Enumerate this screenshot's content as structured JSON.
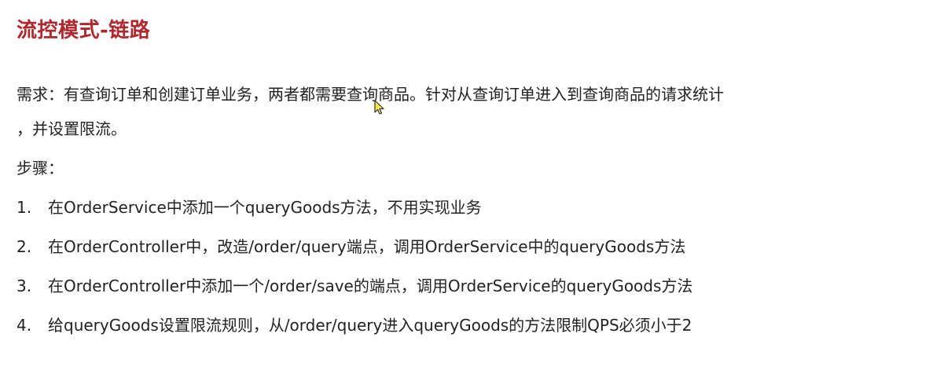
{
  "title": "流控模式-链路",
  "requirement": {
    "line1": "需求：有查询订单和创建订单业务，两者都需要查询商品。针对从查询订单进入到查询商品的请求统计",
    "line2": "，并设置限流。"
  },
  "steps_label": "步骤：",
  "steps": [
    {
      "num": "1.",
      "text": "在OrderService中添加一个queryGoods方法，不用实现业务"
    },
    {
      "num": "2.",
      "text": "在OrderController中，改造/order/query端点，调用OrderService中的queryGoods方法"
    },
    {
      "num": "3.",
      "text": "在OrderController中添加一个/order/save的端点，调用OrderService的queryGoods方法"
    },
    {
      "num": "4.",
      "text": "给queryGoods设置限流规则，从/order/query进入queryGoods的方法限制QPS必须小于2"
    }
  ],
  "colors": {
    "title": "#b3262b",
    "text": "#222222",
    "cursor_fill": "#f5e84a"
  },
  "icons": {
    "cursor": "mouse-pointer-icon"
  }
}
